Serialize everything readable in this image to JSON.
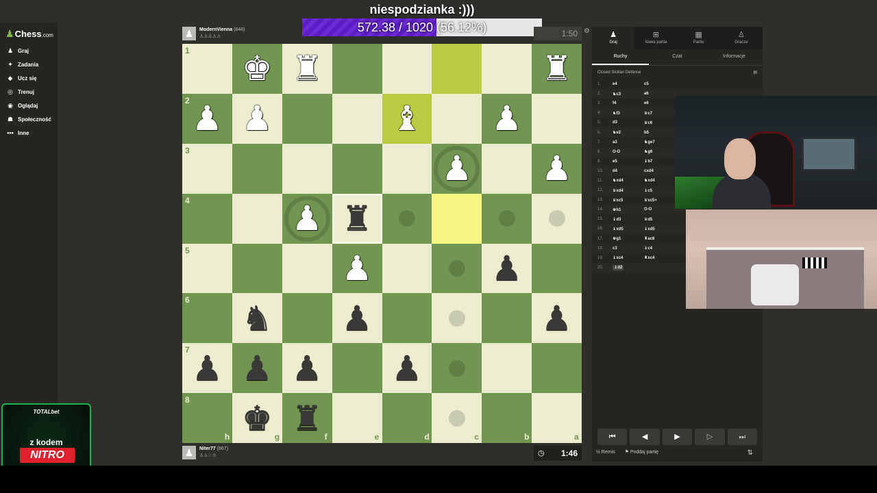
{
  "stream": {
    "title": "niespodzianka :)))",
    "progress_text": "572.38 / 1020 (56.12%)",
    "progress_fraction": 0.5612,
    "progress_color": "#6b2bd6"
  },
  "sidebar": {
    "logo_text": "Chess",
    "logo_suffix": ".com",
    "items": [
      {
        "label": "Graj",
        "icon": "play-icon"
      },
      {
        "label": "Zadania",
        "icon": "puzzle-icon"
      },
      {
        "label": "Ucz się",
        "icon": "learn-icon"
      },
      {
        "label": "Trenuj",
        "icon": "train-icon"
      },
      {
        "label": "Oglądaj",
        "icon": "watch-icon"
      },
      {
        "label": "Społeczność",
        "icon": "community-icon"
      },
      {
        "label": "Inne",
        "icon": "more-icon"
      }
    ]
  },
  "ad": {
    "brand": "TOTALbet",
    "text": "z kodem",
    "code": "NITRO"
  },
  "top_player": {
    "name": "ModernVienna",
    "rating": "(848)",
    "captured": "♙♙♙♙♙",
    "clock": "1:50"
  },
  "bottom_player": {
    "name": "Niter77",
    "rating": "(867)",
    "captured": "♙♙♘♔",
    "clock": "1:46"
  },
  "board": {
    "colors": {
      "light": "#ebecd0",
      "dark": "#739552",
      "hl_light": "#f5f682",
      "hl_dark": "#b9ca43"
    },
    "ranks": [
      "1",
      "2",
      "3",
      "4",
      "5",
      "6",
      "7",
      "8"
    ],
    "files": [
      "h",
      "g",
      "f",
      "e",
      "d",
      "c",
      "b",
      "a"
    ],
    "pieces": [
      {
        "sq": "g1",
        "p": "♚",
        "c": "w"
      },
      {
        "sq": "f1",
        "p": "♜",
        "c": "w"
      },
      {
        "sq": "a1",
        "p": "♜",
        "c": "w"
      },
      {
        "sq": "h2",
        "p": "♟",
        "c": "w"
      },
      {
        "sq": "g2",
        "p": "♟",
        "c": "w"
      },
      {
        "sq": "d2",
        "p": "♝",
        "c": "w"
      },
      {
        "sq": "b2",
        "p": "♟",
        "c": "w"
      },
      {
        "sq": "c3",
        "p": "♟",
        "c": "w"
      },
      {
        "sq": "a3",
        "p": "♟",
        "c": "w"
      },
      {
        "sq": "f4",
        "p": "♟",
        "c": "w"
      },
      {
        "sq": "e4",
        "p": "♜",
        "c": "b"
      },
      {
        "sq": "e5",
        "p": "♟",
        "c": "w"
      },
      {
        "sq": "b5",
        "p": "♟",
        "c": "b"
      },
      {
        "sq": "g6",
        "p": "♞",
        "c": "b"
      },
      {
        "sq": "e6",
        "p": "♟",
        "c": "b"
      },
      {
        "sq": "a6",
        "p": "♟",
        "c": "b"
      },
      {
        "sq": "h7",
        "p": "♟",
        "c": "b"
      },
      {
        "sq": "g7",
        "p": "♟",
        "c": "b"
      },
      {
        "sq": "f7",
        "p": "♟",
        "c": "b"
      },
      {
        "sq": "d7",
        "p": "♟",
        "c": "b"
      },
      {
        "sq": "g8",
        "p": "♚",
        "c": "b"
      },
      {
        "sq": "f8",
        "p": "♜",
        "c": "b"
      }
    ],
    "highlights": [
      "d2",
      "c1",
      "c4"
    ],
    "move_dots": [
      "d4",
      "b4",
      "a4",
      "c5",
      "c6",
      "c7",
      "c8"
    ],
    "capture_rings": [
      "c3",
      "f4"
    ],
    "selected": "e4"
  },
  "panel": {
    "tabs": [
      {
        "label": "Graj",
        "icon": "play-icon"
      },
      {
        "label": "Nowa partia",
        "icon": "plus-icon"
      },
      {
        "label": "Partie",
        "icon": "games-icon"
      },
      {
        "label": "Gracze",
        "icon": "players-icon"
      }
    ],
    "subtabs": [
      "Ruchy",
      "Czat",
      "Informacje"
    ],
    "opening": "Closed Sicilian Defense",
    "moves": [
      {
        "n": "1.",
        "w": "e4",
        "b": "c5"
      },
      {
        "n": "2.",
        "w": "♞c3",
        "b": "a6"
      },
      {
        "n": "3.",
        "w": "f4",
        "b": "e6"
      },
      {
        "n": "4.",
        "w": "♞f3",
        "b": "♛c7"
      },
      {
        "n": "5.",
        "w": "d3",
        "b": "♛c6"
      },
      {
        "n": "6.",
        "w": "♞e2",
        "b": "b5"
      },
      {
        "n": "7.",
        "w": "a3",
        "b": "♞ge7"
      },
      {
        "n": "8.",
        "w": "O-O",
        "b": "♞g6"
      },
      {
        "n": "9.",
        "w": "e5",
        "b": "♝b7"
      },
      {
        "n": "10.",
        "w": "d4",
        "b": "cxd4"
      },
      {
        "n": "11.",
        "w": "♞xd4",
        "b": "♞xd4"
      },
      {
        "n": "12.",
        "w": "♛xd4",
        "b": "♝c5"
      },
      {
        "n": "13.",
        "w": "♛xc5",
        "b": "♛xc5+"
      },
      {
        "n": "14.",
        "w": "♚h1",
        "b": "O-O"
      },
      {
        "n": "15.",
        "w": "♝d3",
        "b": "♛d5"
      },
      {
        "n": "16.",
        "w": "♝xd5",
        "b": "♝xd5"
      },
      {
        "n": "17.",
        "w": "♚g1",
        "b": "♜ac8"
      },
      {
        "n": "18.",
        "w": "c3",
        "b": "♝c4"
      },
      {
        "n": "19.",
        "w": "♝xc4",
        "b": "♜xc4"
      },
      {
        "n": "20.",
        "w": "♝d2",
        "b": ""
      }
    ],
    "nav_buttons": [
      "⏮",
      "◀",
      "▶",
      "▷",
      "⏭"
    ],
    "draw_label": "Remis",
    "resign_label": "Poddaj partię"
  }
}
